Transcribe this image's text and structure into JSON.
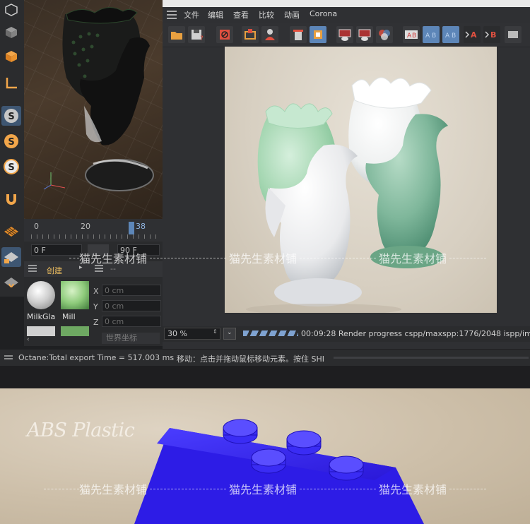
{
  "menu": {
    "items": [
      "文件",
      "编辑",
      "查看",
      "比较",
      "动画",
      "Corona"
    ]
  },
  "timeline": {
    "ticks": [
      "0",
      "20",
      "38"
    ]
  },
  "frames": {
    "start": "0 F",
    "end": "90 F"
  },
  "material_manager": {
    "tab_label": "创建",
    "materials": [
      "MilkGla",
      "Mill"
    ]
  },
  "attributes": {
    "header_value": "--",
    "coords": [
      {
        "axis": "X",
        "value": "0 cm"
      },
      {
        "axis": "Y",
        "value": "0 cm"
      },
      {
        "axis": "Z",
        "value": "0 cm"
      }
    ],
    "space_button": "世界坐标"
  },
  "picture_viewer": {
    "zoom": "30 %",
    "render_status": "00:09:28 Render progress  cspp/maxspp:1776/2048  ispp/ima"
  },
  "status_bar": {
    "export_time": "Octane:Total export Time = 517.003 ms",
    "hint": "移动：点击并拖动鼠标移动元素。按住 SHI"
  },
  "banner": {
    "title": "ABS Plastic"
  },
  "watermark": {
    "text": "猫先生素材铺"
  },
  "colors": {
    "toolbar_bg": "#2b2c2e",
    "accent_blue": "#5d86b8",
    "render_bg": "#ded6c9",
    "jade": "#8fc9a6",
    "lego_blue": "#2d1ce6"
  }
}
